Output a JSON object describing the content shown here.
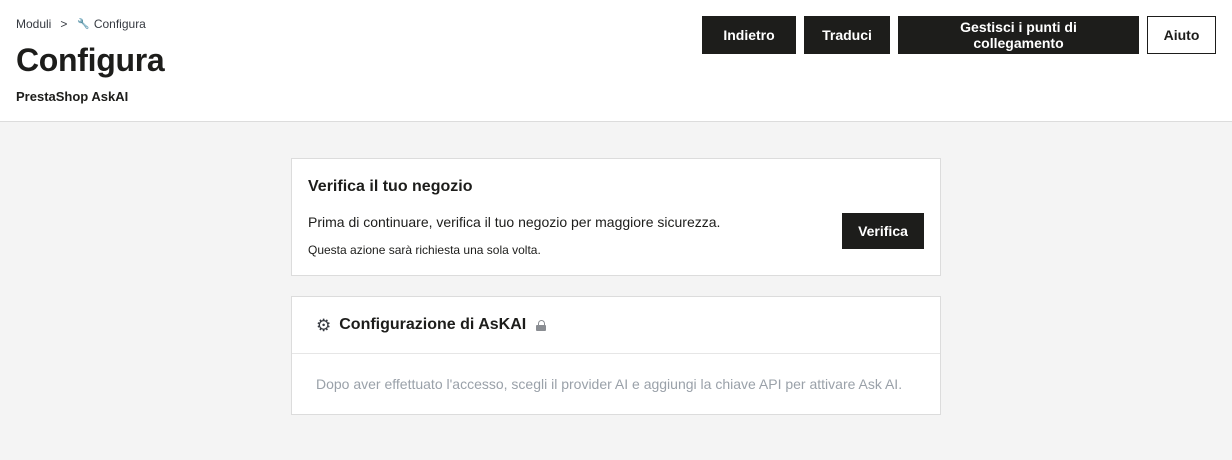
{
  "breadcrumb": {
    "parent": "Moduli",
    "separator": ">",
    "current": "Configura",
    "current_icon": "wrench-icon"
  },
  "page": {
    "title": "Configura",
    "subtitle": "PrestaShop AskAI"
  },
  "toolbar": {
    "back_label": "Indietro",
    "translate_label": "Traduci",
    "hooks_label": "Gestisci i punti di collegamento",
    "help_label": "Aiuto"
  },
  "verify_card": {
    "title": "Verifica il tuo negozio",
    "text": "Prima di continuare, verifica il tuo negozio per maggiore sicurezza.",
    "note": "Questa azione sarà richiesta una sola volta.",
    "button_label": "Verifica"
  },
  "config_card": {
    "icon": "gear-icon",
    "title": "Configurazione di AsKAI",
    "status_icon": "lock-icon",
    "message": "Dopo aver effettuato l'accesso, scegli il provider AI e aggiungi la chiave API per attivare Ask AI."
  },
  "colors": {
    "dark_button": "#1d1d1b",
    "page_background": "#f4f4f4",
    "muted_text": "#9aa1a9"
  }
}
